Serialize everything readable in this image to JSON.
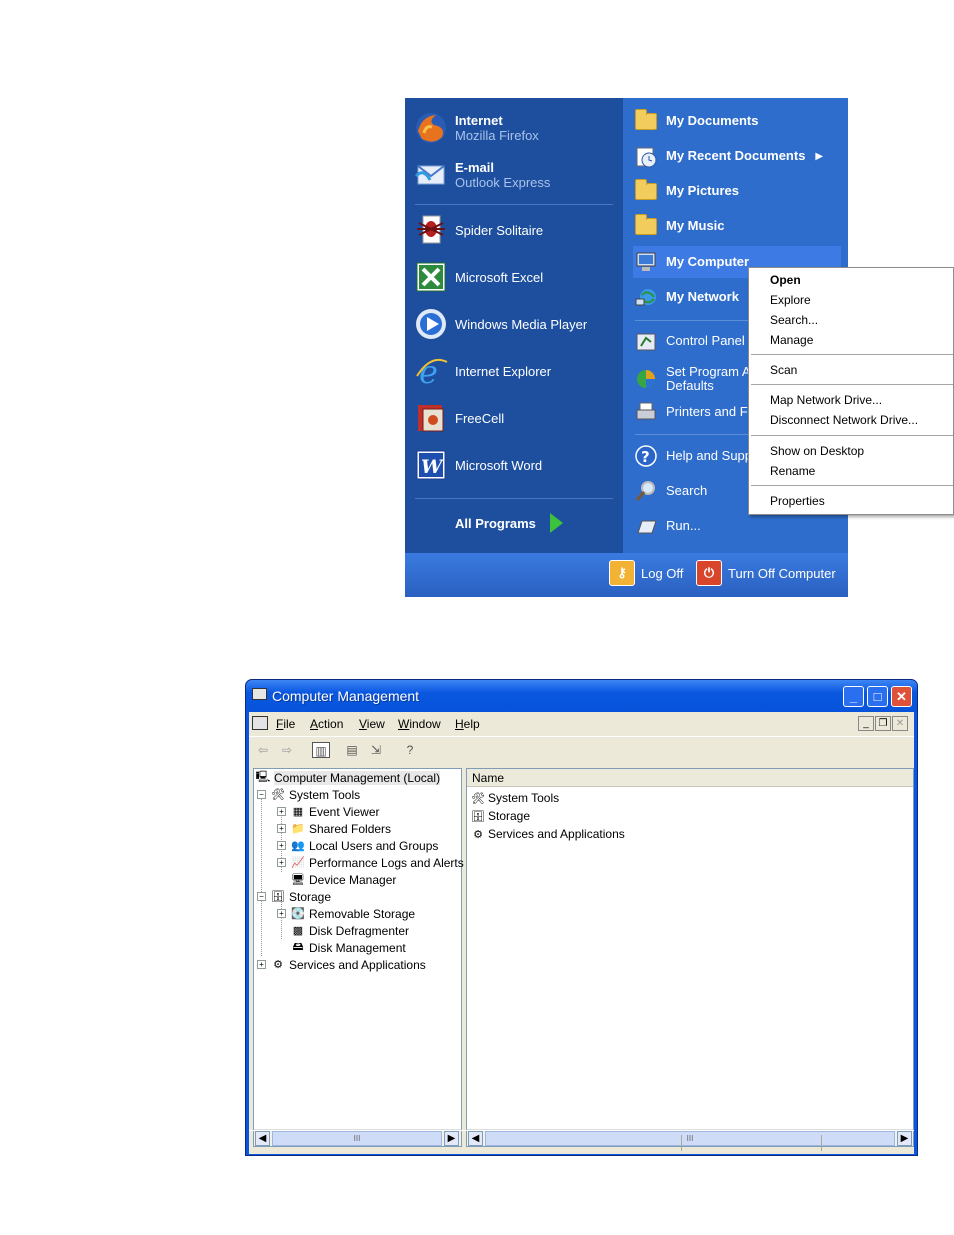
{
  "start_menu": {
    "pinned": [
      {
        "title": "Internet",
        "subtitle": "Mozilla Firefox",
        "icon": "firefox-icon"
      },
      {
        "title": "E-mail",
        "subtitle": "Outlook Express",
        "icon": "outlook-express-icon"
      }
    ],
    "recent": [
      {
        "label": "Spider Solitaire",
        "icon": "spider-solitaire-icon"
      },
      {
        "label": "Microsoft Excel",
        "icon": "excel-icon"
      },
      {
        "label": "Windows Media Player",
        "icon": "media-player-icon"
      },
      {
        "label": "Internet Explorer",
        "icon": "internet-explorer-icon"
      },
      {
        "label": "FreeCell",
        "icon": "freecell-icon"
      },
      {
        "label": "Microsoft Word",
        "icon": "word-icon"
      }
    ],
    "all_programs": "All Programs",
    "places": [
      {
        "label": "My Documents",
        "icon": "folder-icon"
      },
      {
        "label": "My Recent Documents",
        "icon": "recent-documents-icon"
      },
      {
        "label": "My Pictures",
        "icon": "folder-icon"
      },
      {
        "label": "My Music",
        "icon": "folder-icon"
      },
      {
        "label": "My Computer",
        "icon": "computer-icon"
      },
      {
        "label": "My Network",
        "icon": "network-icon"
      }
    ],
    "system": [
      {
        "label": "Control Panel",
        "icon": "control-panel-icon"
      },
      {
        "label": "Set Program Access and",
        "label2": "Defaults",
        "icon": "program-defaults-icon"
      },
      {
        "label": "Printers and Faxes",
        "icon": "printer-icon"
      },
      {
        "label": "Help and Support",
        "icon": "help-icon"
      },
      {
        "label": "Search",
        "icon": "search-icon"
      },
      {
        "label": "Run...",
        "icon": "run-icon"
      }
    ],
    "log_off": "Log Off",
    "turn_off": "Turn Off Computer",
    "colors": {
      "left_bg": "#1d4f9e",
      "right_bg": "#2e6dcb",
      "bottom_bg": "#3a7be0"
    }
  },
  "context_menu": {
    "items": [
      "Open",
      "Explore",
      "Search...",
      "Manage",
      "Scan",
      "Map Network Drive...",
      "Disconnect Network Drive...",
      "Show on Desktop",
      "Rename",
      "Properties"
    ]
  },
  "window": {
    "title": "Computer Management",
    "menu": [
      "File",
      "Action",
      "View",
      "Window",
      "Help"
    ],
    "menu_access_keys": [
      "F",
      "A",
      "V",
      "W",
      "H"
    ],
    "tree": [
      {
        "label": "Computer Management (Local)",
        "icon": "computer-management-icon"
      },
      {
        "label": "System Tools",
        "icon": "system-tools-icon"
      },
      {
        "label": "Event Viewer",
        "icon": "event-viewer-icon"
      },
      {
        "label": "Shared Folders",
        "icon": "shared-folders-icon"
      },
      {
        "label": "Local Users and Groups",
        "icon": "users-icon"
      },
      {
        "label": "Performance Logs and Alerts",
        "icon": "performance-icon"
      },
      {
        "label": "Device Manager",
        "icon": "device-manager-icon"
      },
      {
        "label": "Storage",
        "icon": "storage-icon"
      },
      {
        "label": "Removable Storage",
        "icon": "removable-storage-icon"
      },
      {
        "label": "Disk Defragmenter",
        "icon": "defragmenter-icon"
      },
      {
        "label": "Disk Management",
        "icon": "disk-management-icon"
      },
      {
        "label": "Services and Applications",
        "icon": "services-icon"
      }
    ],
    "list_header": "Name",
    "list_items": [
      "System Tools",
      "Storage",
      "Services and Applications"
    ],
    "scroll_grip": "III",
    "colors": {
      "titlebar": "#0a57e0",
      "client": "#ece9d8"
    }
  }
}
